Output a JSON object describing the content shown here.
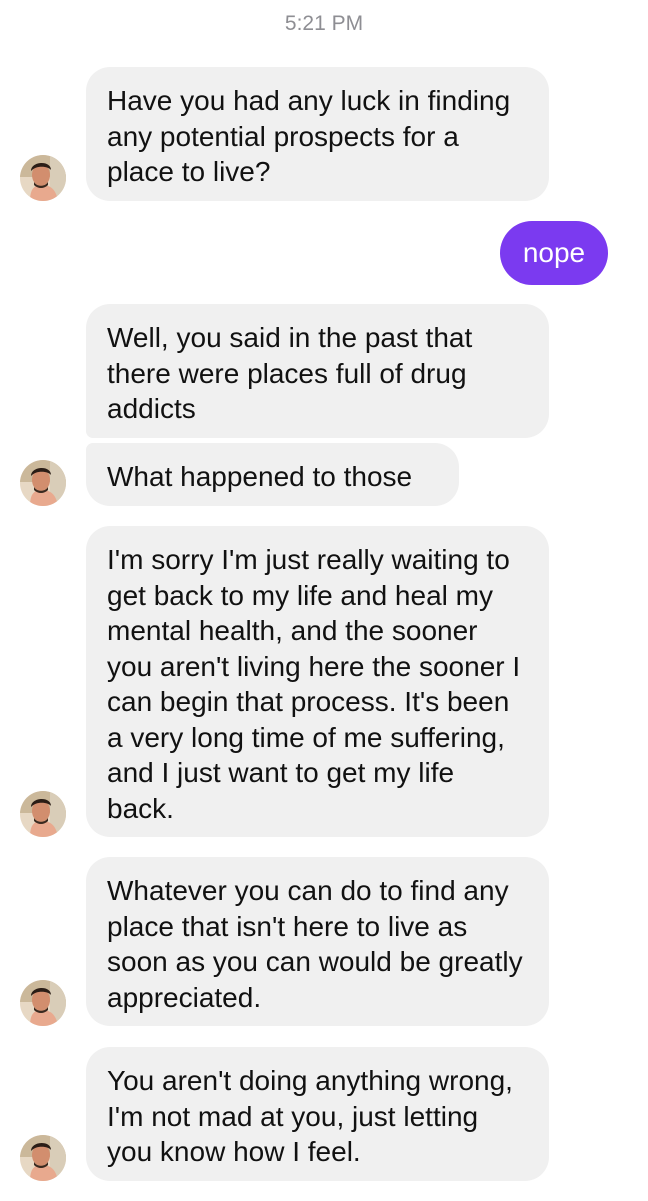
{
  "timestamp": "5:21 PM",
  "messages": [
    {
      "text": "Have you had any luck in finding any potential prospects for a place to live?"
    },
    {
      "text": "nope"
    },
    {
      "text": "Well, you said in the past that there were places full of drug addicts"
    },
    {
      "text": "What happened to those"
    },
    {
      "text": "I'm sorry I'm just really waiting to get back to my life and heal my mental health, and the sooner you aren't living here the sooner I can begin that process. It's been a very long time of me suffering, and I just want to get my life back."
    },
    {
      "text": "Whatever you can do to find any place that isn't here to live as soon as you can would be greatly appreciated."
    },
    {
      "text": "You aren't doing anything wrong, I'm not mad at you, just letting you know how I feel."
    }
  ],
  "colors": {
    "incoming_bubble": "#f0f0f0",
    "outgoing_bubble": "#7b3af0",
    "timestamp": "#8e8e93"
  },
  "icons": {
    "avatar": "contact-avatar-photo"
  }
}
